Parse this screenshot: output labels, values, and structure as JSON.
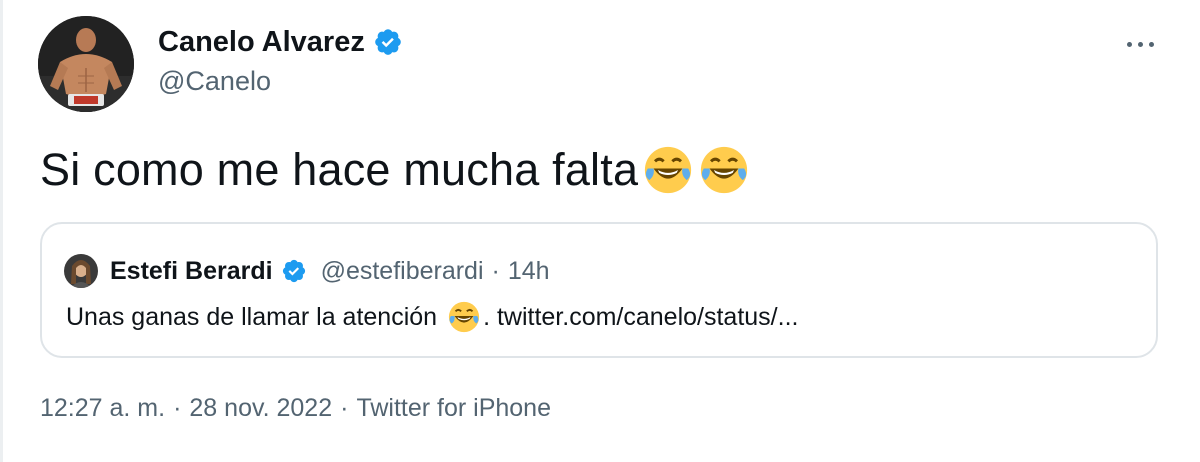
{
  "tweet": {
    "author": {
      "display_name": "Canelo Alvarez",
      "handle": "@Canelo",
      "verified_icon": "verified-badge-icon"
    },
    "more_icon": "more-options-icon",
    "text": "Si como me hace mucha falta",
    "emojis": [
      "face-with-tears-of-joy-emoji",
      "face-with-tears-of-joy-emoji"
    ],
    "quoted": {
      "display_name": "Estefi Berardi",
      "handle": "@estefiberardi",
      "separator": "·",
      "time": "14h",
      "text": "Unas ganas de llamar la atención",
      "link": ". twitter.com/canelo/status/...",
      "emoji": "face-with-tears-of-joy-emoji"
    },
    "meta": {
      "time": "12:27 a. m.",
      "sep1": "·",
      "date": "28 nov. 2022",
      "sep2": "·",
      "source": "Twitter for iPhone"
    }
  },
  "colors": {
    "text_primary": "#0f1419",
    "text_secondary": "#536471",
    "verified_blue": "#1d9bf0",
    "border": "#dfe4e8"
  }
}
